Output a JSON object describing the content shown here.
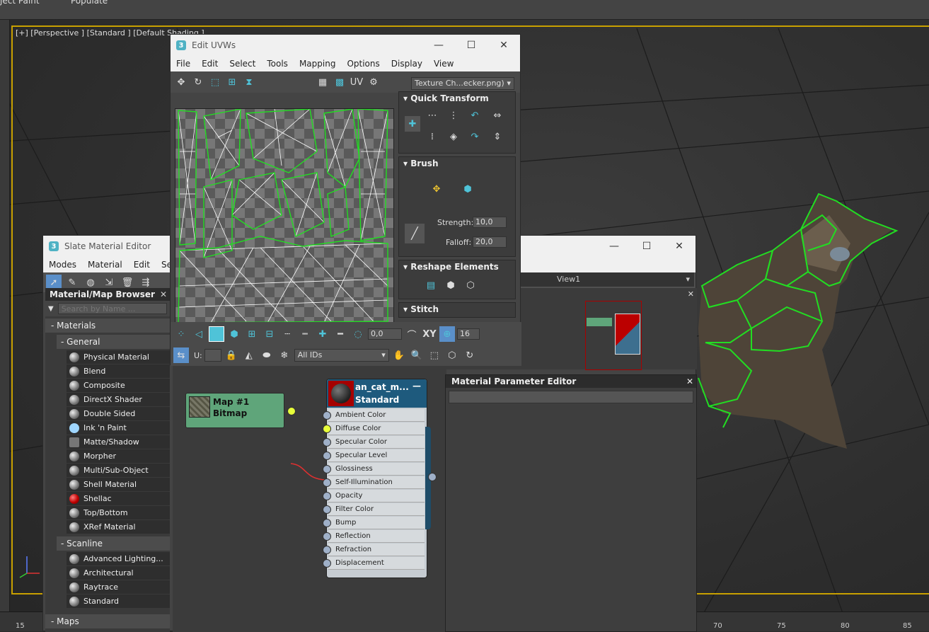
{
  "top_strip": {
    "left_text": "ject Paint",
    "right_text": "Populate"
  },
  "viewport": {
    "label": "[+] [Perspective ] [Standard ] [Default Shading ]"
  },
  "timeline": {
    "ticks": [
      "15",
      "70",
      "75",
      "80",
      "85"
    ]
  },
  "uvw": {
    "title": "Edit UVWs",
    "menu": [
      "File",
      "Edit",
      "Select",
      "Tools",
      "Mapping",
      "Options",
      "Display",
      "View"
    ],
    "texture_dropdown": "Texture Ch...ecker.png)",
    "uv_label": "UV",
    "rollouts": {
      "quick_transform": "Quick Transform",
      "brush": "Brush",
      "strength_label": "Strength:",
      "strength_value": "10,0",
      "falloff_label": "Falloff:",
      "falloff_value": "20,0",
      "reshape": "Reshape Elements",
      "stitch": "Stitch"
    },
    "bottom": {
      "angle_value": "0,0",
      "xy_label": "XY",
      "grid_value": "16",
      "u_label": "U:",
      "ids_dropdown": "All IDs"
    }
  },
  "slate": {
    "title": "Slate Material Editor",
    "menu": [
      "Modes",
      "Material",
      "Edit",
      "Select"
    ],
    "view_tab": "View1",
    "browser": {
      "title": "Material/Map Browser",
      "search_placeholder": "Search by Name ...",
      "materials_header": "Materials",
      "general_header": "General",
      "general_items": [
        {
          "label": "Physical Material",
          "icon": "sphere"
        },
        {
          "label": "Blend",
          "icon": "sphere"
        },
        {
          "label": "Composite",
          "icon": "sphere"
        },
        {
          "label": "DirectX Shader",
          "icon": "sphere"
        },
        {
          "label": "Double Sided",
          "icon": "sphere"
        },
        {
          "label": "Ink 'n Paint",
          "icon": "blue"
        },
        {
          "label": "Matte/Shadow",
          "icon": "square"
        },
        {
          "label": "Morpher",
          "icon": "sphere"
        },
        {
          "label": "Multi/Sub-Object",
          "icon": "sphere"
        },
        {
          "label": "Shell Material",
          "icon": "sphere"
        },
        {
          "label": "Shellac",
          "icon": "red"
        },
        {
          "label": "Top/Bottom",
          "icon": "sphere"
        },
        {
          "label": "XRef Material",
          "icon": "sphere"
        }
      ],
      "scanline_header": "Scanline",
      "scanline_items": [
        {
          "label": "Advanced Lighting...",
          "icon": "sphere"
        },
        {
          "label": "Architectural",
          "icon": "sphere"
        },
        {
          "label": "Raytrace",
          "icon": "sphere"
        },
        {
          "label": "Standard",
          "icon": "sphere"
        }
      ],
      "maps_header": "Maps"
    },
    "bitmap_node": {
      "name": "Map #1",
      "type": "Bitmap"
    },
    "material_node": {
      "name": "an_cat_m...",
      "type": "Standard",
      "slots": [
        "Ambient Color",
        "Diffuse Color",
        "Specular Color",
        "Specular Level",
        "Glossiness",
        "Self-Illumination",
        "Opacity",
        "Filter Color",
        "Bump",
        "Reflection",
        "Refraction",
        "Displacement"
      ]
    },
    "param_editor_title": "Material Parameter Editor"
  },
  "colors": {
    "viewport_border": "#c8a000",
    "uv_wire_green": "#22dd22",
    "node_green": "#5fa57a",
    "node_header": "#1e5a7d"
  }
}
